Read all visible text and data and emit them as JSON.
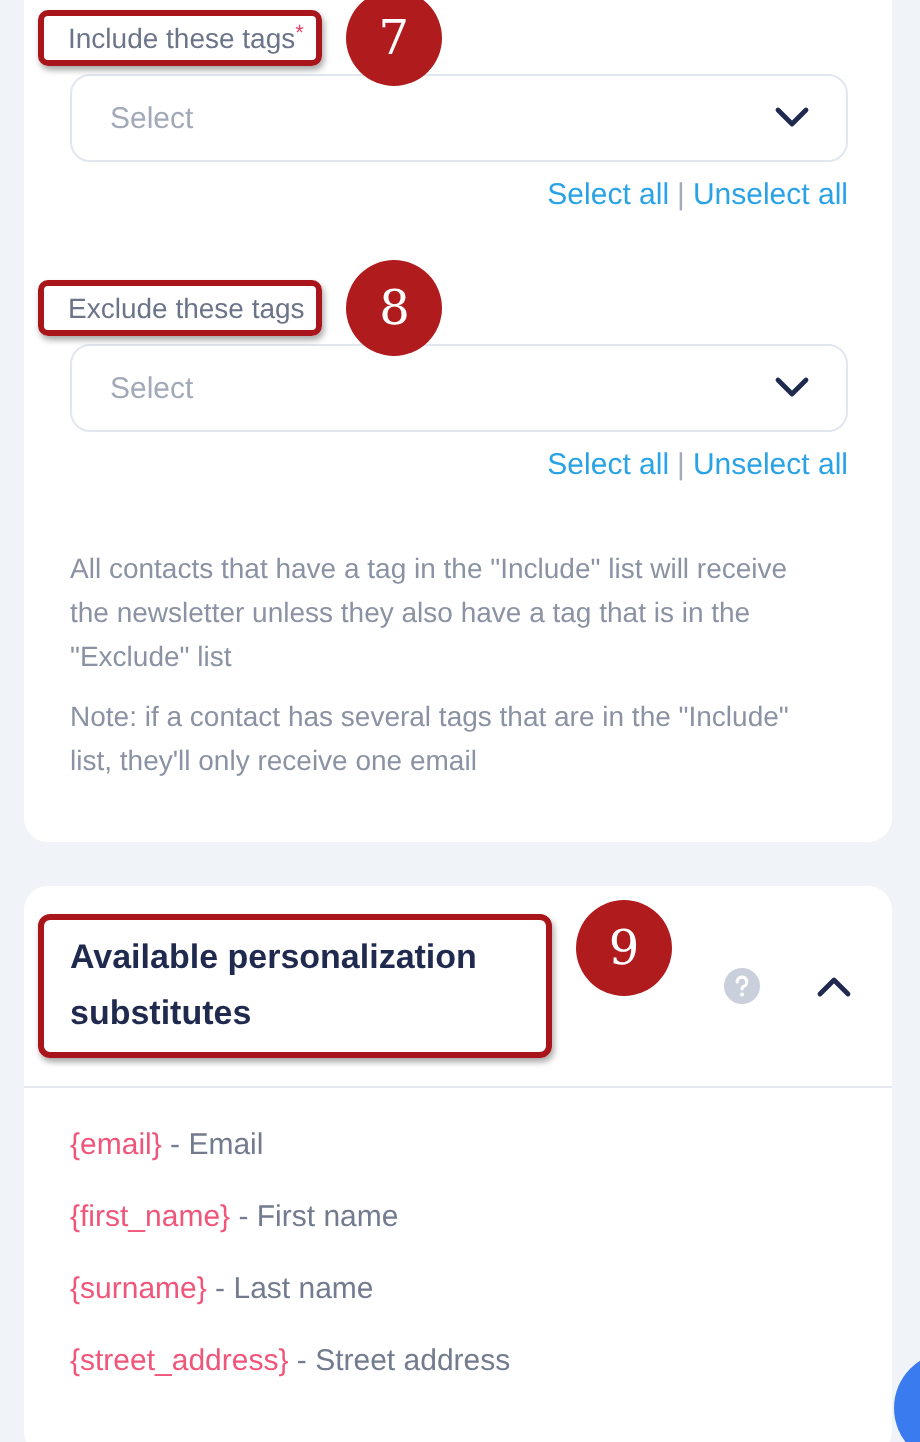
{
  "tag_filters": [
    {
      "label": "Include these tags",
      "required_mark": "*",
      "callout": "7",
      "placeholder": "Select",
      "select_all": "Select all",
      "separator": "|",
      "unselect_all": "Unselect all"
    },
    {
      "label": "Exclude these tags",
      "callout": "8",
      "placeholder": "Select",
      "select_all": "Select all",
      "separator": "|",
      "unselect_all": "Unselect all"
    }
  ],
  "notes": [
    "All contacts that have a tag in the \"Include\" list will receive the newsletter unless they also have a tag that is in the \"Exclude\" list",
    "Note: if a contact has several tags that are in the \"Include\" list, they'll only receive one email"
  ],
  "substitutes_panel": {
    "title": "Available personalization substitutes",
    "callout": "9",
    "expanded": true,
    "items": [
      {
        "token": "{email}",
        "description": "- Email"
      },
      {
        "token": "{first_name}",
        "description": "- First name"
      },
      {
        "token": "{surname}",
        "description": "- Last name"
      },
      {
        "token": "{street_address}",
        "description": "- Street address"
      }
    ]
  }
}
